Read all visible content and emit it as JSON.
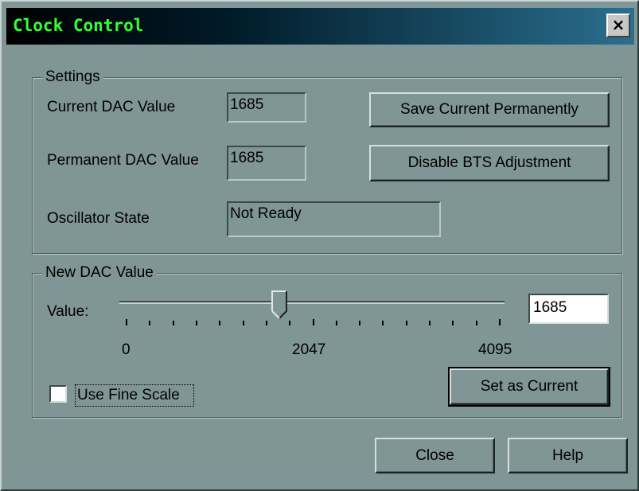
{
  "window": {
    "title": "Clock Control",
    "close_glyph": "×",
    "title_color": "#33ff33"
  },
  "settings": {
    "group_label": "Settings",
    "current_dac_label": "Current DAC Value",
    "current_dac_value": "1685",
    "permanent_dac_label": "Permanent DAC Value",
    "permanent_dac_value": "1685",
    "oscillator_label": "Oscillator State",
    "oscillator_value": "Not Ready",
    "save_button": "Save Current Permanently",
    "disable_button": "Disable BTS Adjustment"
  },
  "new_dac": {
    "group_label": "New DAC Value",
    "value_label": "Value:",
    "value": "1685",
    "slider": {
      "min": 0,
      "max": 4095,
      "value": 1685
    },
    "tick_labels": [
      "0",
      "2047",
      "4095"
    ],
    "fine_scale_label": "Use Fine Scale",
    "fine_scale_checked": false,
    "set_current_button": "Set as Current"
  },
  "footer": {
    "close_button": "Close",
    "help_button": "Help"
  }
}
